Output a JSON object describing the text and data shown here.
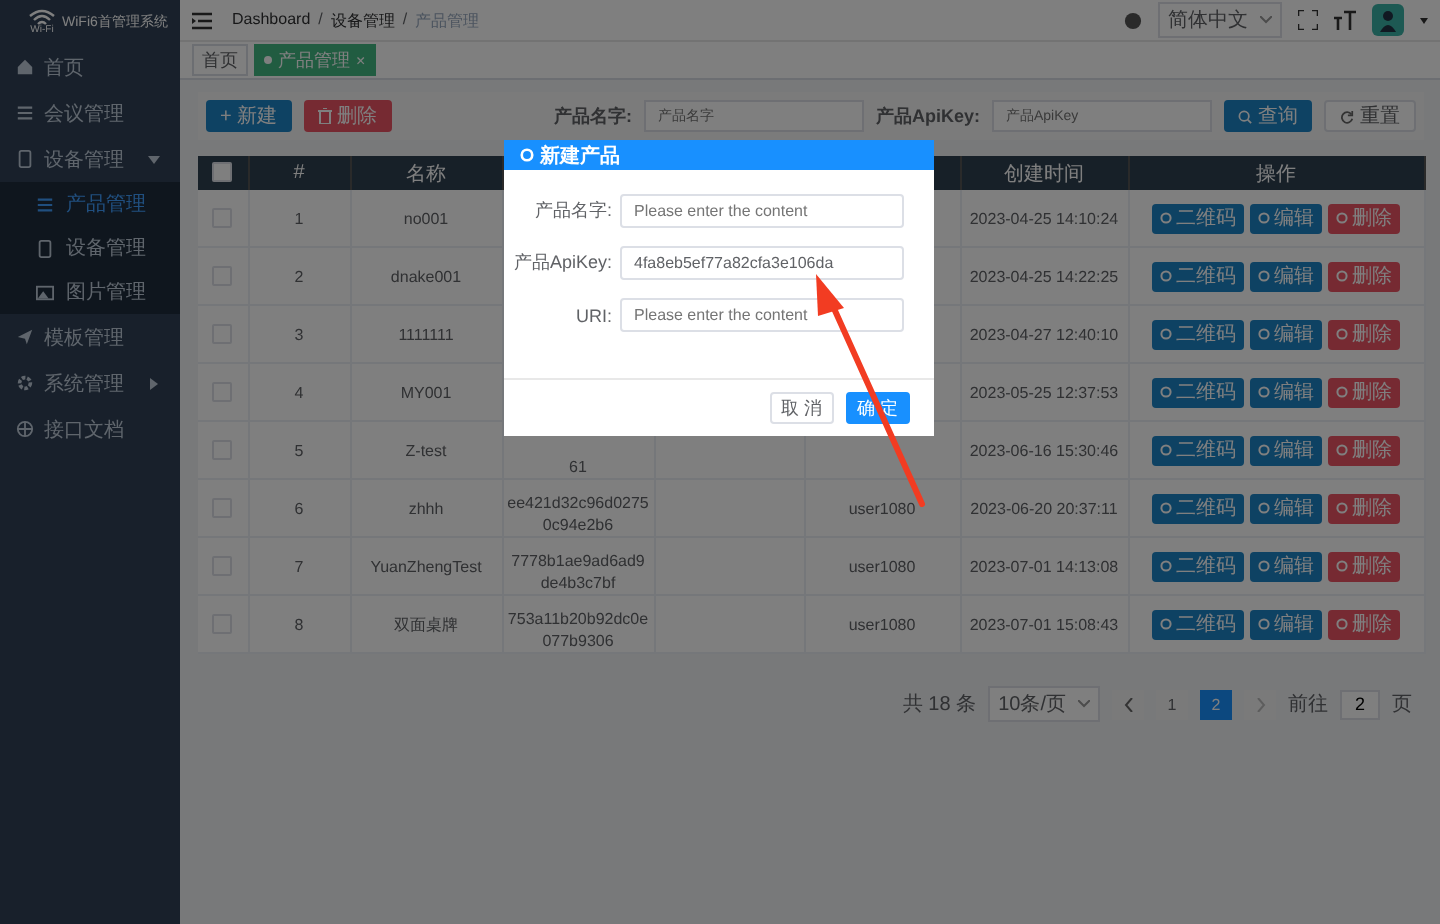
{
  "sidebar": {
    "logo_caption": "Wi-Fi",
    "title": "WiFi6首管理系统",
    "items": [
      {
        "label": "首页",
        "kind": "link"
      },
      {
        "label": "会议管理",
        "kind": "link"
      },
      {
        "label": "设备管理",
        "kind": "group",
        "expanded": true,
        "children": [
          {
            "label": "产品管理",
            "selected": true
          },
          {
            "label": "设备管理",
            "selected": false
          },
          {
            "label": "图片管理",
            "selected": false
          }
        ]
      },
      {
        "label": "模板管理",
        "kind": "link"
      },
      {
        "label": "系统管理",
        "kind": "group",
        "expanded": false
      },
      {
        "label": "接口文档",
        "kind": "link"
      }
    ]
  },
  "breadcrumb": [
    {
      "label": "Dashboard"
    },
    {
      "separator": "/",
      "label": "设备管理"
    },
    {
      "separator": "/",
      "label": "产品管理"
    }
  ],
  "language": "简体中文",
  "tags": [
    {
      "label": "首页",
      "selected": false
    },
    {
      "label": "产品管理",
      "selected": true,
      "close": "×"
    }
  ],
  "toolbar": {
    "add": "+ 新建",
    "delete": "删除"
  },
  "search": {
    "fields": [
      {
        "label": "产品名字:",
        "placeholder": "产品名字"
      },
      {
        "label": "产品ApiKey:",
        "placeholder": "产品ApiKey"
      }
    ],
    "query": "查询",
    "reset": "重置"
  },
  "table": {
    "all_checked": false,
    "columns": {
      "index": "#",
      "name": "名称",
      "created": "创建时间",
      "actions": "操作"
    },
    "rows": [
      {
        "checked": false,
        "index": "1",
        "name": "no001",
        "created": "2023-04-25 14:10:24",
        "actions": [
          "二维码",
          "编辑",
          "删除"
        ]
      },
      {
        "checked": false,
        "index": "2",
        "name": "dnake001",
        "created": "2023-04-25 14:22:25",
        "actions": [
          "二维码",
          "编辑",
          "删除"
        ]
      },
      {
        "checked": false,
        "index": "3",
        "name": "1111111",
        "created": "2023-04-27 12:40:10",
        "actions": [
          "二维码",
          "编辑",
          "删除"
        ]
      },
      {
        "checked": false,
        "index": "4",
        "name": "MY001",
        "created": "2023-05-25 12:37:53",
        "actions": [
          "二维码",
          "编辑",
          "删除"
        ]
      },
      {
        "checked": false,
        "index": "5",
        "name": "Z-test",
        "key": "61",
        "created": "2023-06-16 15:30:46",
        "actions": [
          "二维码",
          "编辑",
          "删除"
        ]
      },
      {
        "checked": false,
        "index": "6",
        "name": "zhhh",
        "key": "ee421d32c96d02750c94e2b6",
        "user": "user1080",
        "created": "2023-06-20 20:37:11",
        "actions": [
          "二维码",
          "编辑",
          "删除"
        ]
      },
      {
        "checked": false,
        "index": "7",
        "name": "YuanZhengTest",
        "key": "7778b1ae9ad6ad9de4b3c7bf",
        "user": "user1080",
        "created": "2023-07-01 14:13:08",
        "actions": [
          "二维码",
          "编辑",
          "删除"
        ]
      },
      {
        "checked": false,
        "index": "8",
        "name": "双面桌牌",
        "key": "753a11b20b92dc0e077b9306",
        "user": "user1080",
        "created": "2023-07-01 15:08:43",
        "actions": [
          "二维码",
          "编辑",
          "删除"
        ]
      }
    ]
  },
  "pagination": {
    "total": "共 18 条",
    "page_size": "10条/页",
    "pages": [
      {
        "label": "1",
        "selected": false
      },
      {
        "label": "2",
        "selected": true
      }
    ],
    "goto": "前往",
    "goto_value": "2",
    "goto_unit": "页"
  },
  "modal": {
    "title": "新建产品",
    "fields": [
      {
        "label": "产品名字:",
        "placeholder": "Please enter the content"
      },
      {
        "label": "产品ApiKey:",
        "value": "4fa8eb5ef77a82cfa3e106da"
      },
      {
        "label": "URI:",
        "placeholder": "Please enter the content"
      }
    ],
    "buttons": [
      {
        "label": "取 消",
        "kind": "default"
      },
      {
        "label": "确 定",
        "kind": "primary"
      }
    ]
  }
}
